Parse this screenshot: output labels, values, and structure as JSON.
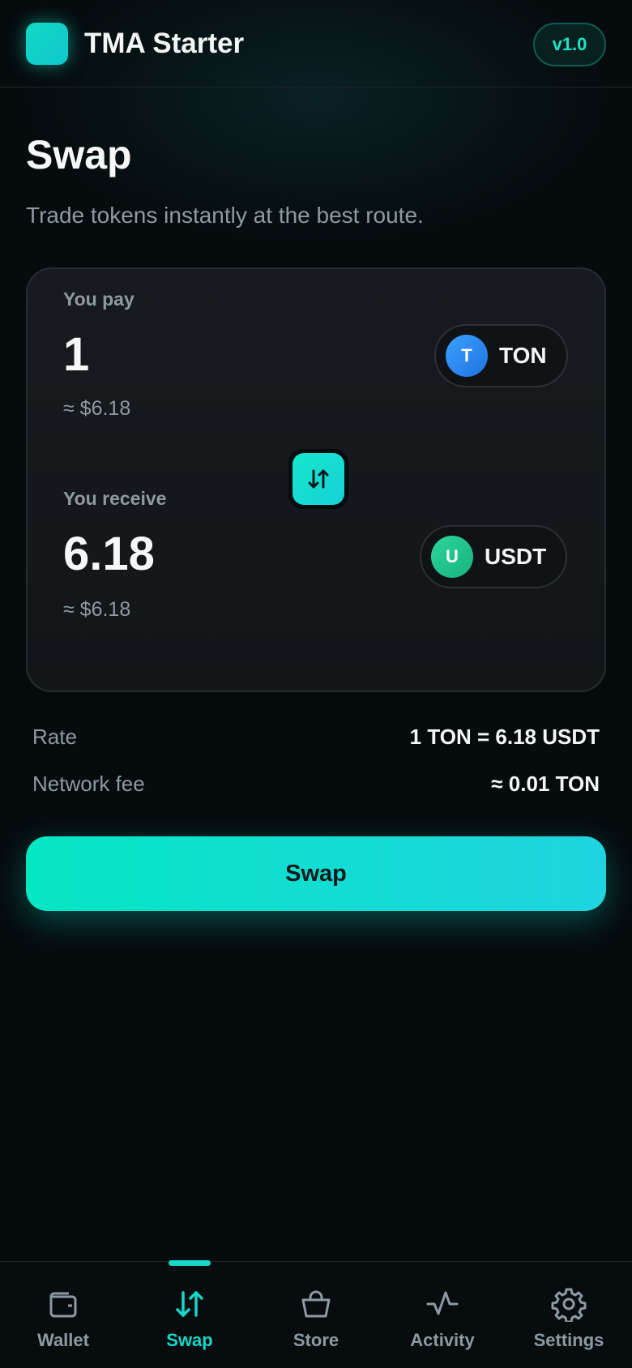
{
  "header": {
    "app_title": "TMA Starter",
    "version": "v1.0"
  },
  "page": {
    "title": "Swap",
    "subtitle": "Trade tokens instantly at the best route."
  },
  "pay": {
    "label": "You pay",
    "amount": "1",
    "fiat": "≈ $6.18",
    "token": {
      "symbol": "TON",
      "icon_letter": "T",
      "icon_color": "#2f8ff0"
    }
  },
  "receive": {
    "label": "You receive",
    "amount": "6.18",
    "fiat": "≈ $6.18",
    "token": {
      "symbol": "USDT",
      "icon_letter": "U",
      "icon_color": "#22c98f"
    }
  },
  "swap_direction_icon": "swap-vertical-icon",
  "details": [
    {
      "label": "Rate",
      "value": "1 TON = 6.18 USDT"
    },
    {
      "label": "Network fee",
      "value": "≈ 0.01 TON"
    }
  ],
  "cta": {
    "label": "Swap"
  },
  "nav": [
    {
      "label": "Wallet",
      "icon": "wallet-icon",
      "active": false
    },
    {
      "label": "Swap",
      "icon": "swap-icon",
      "active": true
    },
    {
      "label": "Store",
      "icon": "shopping-bag-icon",
      "active": false
    },
    {
      "label": "Activity",
      "icon": "activity-icon",
      "active": false
    },
    {
      "label": "Settings",
      "icon": "gear-icon",
      "active": false
    }
  ],
  "colors": {
    "accent": "#18d6c8",
    "background": "#060b0e",
    "muted_text": "#8e9aa1"
  }
}
